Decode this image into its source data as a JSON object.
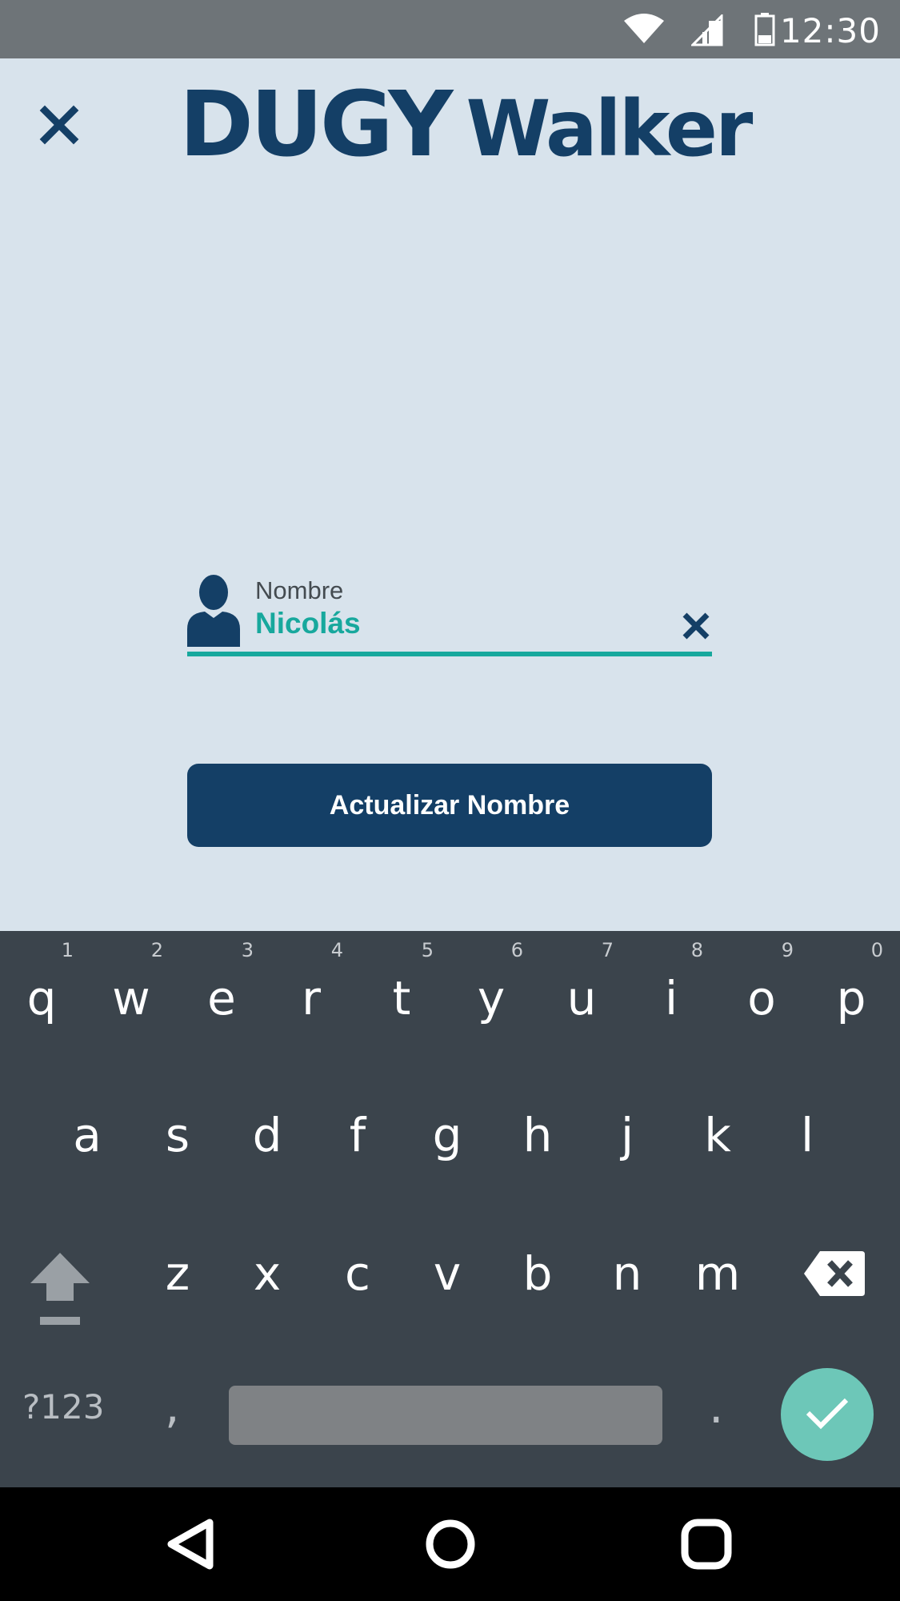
{
  "status_bar": {
    "time": "12:30",
    "icons": [
      "wifi-icon",
      "signal-icon",
      "battery-icon"
    ]
  },
  "app_bar": {
    "close_icon": "close-icon",
    "logo": {
      "part1": "DUGY",
      "part2": "Walker"
    }
  },
  "form": {
    "name_field": {
      "icon": "user-icon",
      "label": "Nombre",
      "value": "Nicolás",
      "clear_icon": "clear-icon"
    },
    "submit_label": "Actualizar Nombre"
  },
  "keyboard": {
    "row1": [
      {
        "key": "q",
        "hint": "1"
      },
      {
        "key": "w",
        "hint": "2"
      },
      {
        "key": "e",
        "hint": "3"
      },
      {
        "key": "r",
        "hint": "4"
      },
      {
        "key": "t",
        "hint": "5"
      },
      {
        "key": "y",
        "hint": "6"
      },
      {
        "key": "u",
        "hint": "7"
      },
      {
        "key": "i",
        "hint": "8"
      },
      {
        "key": "o",
        "hint": "9"
      },
      {
        "key": "p",
        "hint": "0"
      }
    ],
    "row2": [
      "a",
      "s",
      "d",
      "f",
      "g",
      "h",
      "j",
      "k",
      "l"
    ],
    "row3": [
      "z",
      "x",
      "c",
      "v",
      "b",
      "n",
      "m"
    ],
    "symbols_label": "?123",
    "comma": ",",
    "period": ".",
    "icons": [
      "shift-icon",
      "backspace-icon",
      "enter-check-icon"
    ]
  },
  "nav_bar": {
    "icons": [
      "back-icon",
      "home-icon",
      "recents-icon"
    ]
  },
  "colors": {
    "brand_navy": "#143f66",
    "accent_teal": "#17a89d",
    "background": "#d8e3ec",
    "keyboard_bg": "#3b444c",
    "enter_key": "#6dc7b8"
  }
}
